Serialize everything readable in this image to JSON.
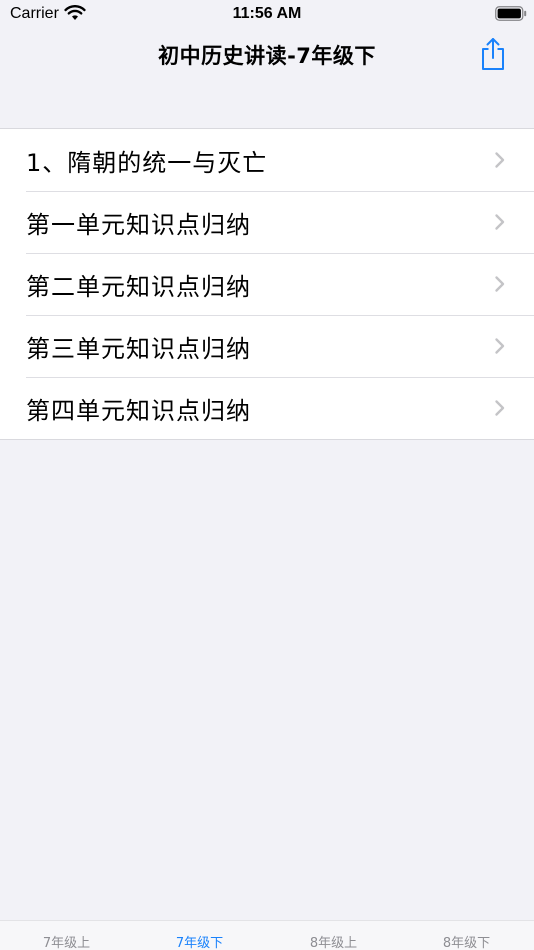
{
  "status_bar": {
    "carrier": "Carrier",
    "time": "11:56 AM"
  },
  "nav": {
    "title": "初中历史讲读-7年级下",
    "share_icon": "share-icon",
    "accent_color": "#1a82fb"
  },
  "list": {
    "items": [
      {
        "label": "1、隋朝的统一与灭亡"
      },
      {
        "label": "第一单元知识点归纳"
      },
      {
        "label": "第二单元知识点归纳"
      },
      {
        "label": "第三单元知识点归纳"
      },
      {
        "label": "第四单元知识点归纳"
      }
    ]
  },
  "tab_bar": {
    "tabs": [
      {
        "label": "7年级上",
        "selected": false
      },
      {
        "label": "7年级下",
        "selected": true
      },
      {
        "label": "8年级上",
        "selected": false
      },
      {
        "label": "8年级下",
        "selected": false
      }
    ]
  }
}
